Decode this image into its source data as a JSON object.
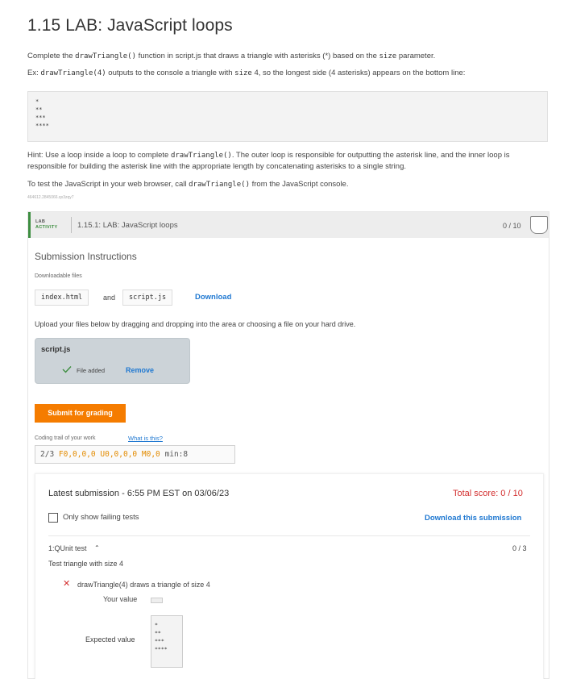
{
  "page": {
    "title": "1.15 LAB: JavaScript loops",
    "p1_a": "Complete the ",
    "p1_code1": "drawTriangle()",
    "p1_b": " function in script.js that draws a triangle with asterisks (*) based on the ",
    "p1_code2": "size",
    "p1_c": " parameter.",
    "p2_a": "Ex: ",
    "p2_code1": "drawTriangle(4)",
    "p2_b": " outputs to the console a triangle with ",
    "p2_code2": "size",
    "p2_c": " 4, so the longest side (4 asterisks) appears on the bottom line:",
    "example_lines": [
      "*",
      "**",
      "***",
      "****"
    ],
    "hint_a": "Hint: Use a loop inside a loop to complete ",
    "hint_code": "drawTriangle()",
    "hint_b": ". The outer loop is responsible for outputting the asterisk line, and the inner loop is responsible for building the asterisk line with the appropriate length by concatenating asterisks to a single string.",
    "p4_a": "To test the JavaScript in your web browser, call ",
    "p4_code": "drawTriangle()",
    "p4_b": " from the JavaScript console.",
    "small_id": "464612.2845066.qx3zqy7"
  },
  "activity": {
    "tag_line1": "LAB",
    "tag_line2": "ACTIVITY",
    "title": "1.15.1: LAB: JavaScript loops",
    "score": "0 / 10",
    "submission_instructions": "Submission Instructions",
    "downloadable_label": "Downloadable files",
    "file1": "index.html",
    "and": "and",
    "file2": "script.js",
    "download": "Download",
    "upload_text": "Upload your files below by dragging and dropping into the area or choosing a file on your hard drive.",
    "uploaded_file": "script.js",
    "file_added": "File added",
    "remove": "Remove",
    "submit": "Submit for grading",
    "trail_label": "Coding trail of your work",
    "trail_link": "What is this?",
    "trail_prefix": "2/3 ",
    "trail_f": "F0,0,0,0",
    "trail_u": "U0,0,0,0",
    "trail_m": "M0,0",
    "trail_min": " min:8"
  },
  "results": {
    "latest": "Latest submission - 6:55 PM EST on 03/06/23",
    "total": "Total score: 0 / 10",
    "only_failing": "Only show failing tests",
    "download_sub": "Download this submission",
    "test_title": "1:QUnit test",
    "test_score": "0 / 3",
    "test_desc": "Test triangle with size 4",
    "fail_desc": "drawTriangle(4) draws a triangle of size 4",
    "your_value": "Your value",
    "expected_value": "Expected value",
    "expected_lines": [
      "*",
      "**",
      "***",
      "****"
    ]
  },
  "colors": {
    "accent_orange": "#f57c00",
    "link_blue": "#1f78d1",
    "error_red": "#d32f2f",
    "lab_green": "#3e8e41"
  }
}
